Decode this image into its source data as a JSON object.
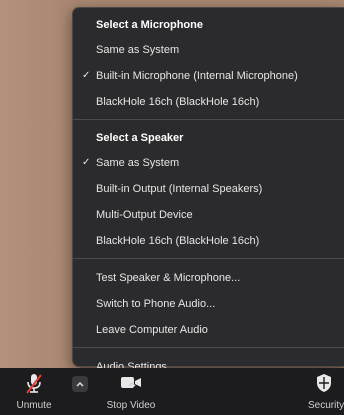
{
  "menu": {
    "microphone_header": "Select a Microphone",
    "microphone_items": [
      {
        "label": "Same as System",
        "checked": false
      },
      {
        "label": "Built-in Microphone (Internal Microphone)",
        "checked": true
      },
      {
        "label": "BlackHole 16ch (BlackHole 16ch)",
        "checked": false
      }
    ],
    "speaker_header": "Select a Speaker",
    "speaker_items": [
      {
        "label": "Same as System",
        "checked": true
      },
      {
        "label": "Built-in Output (Internal Speakers)",
        "checked": false
      },
      {
        "label": "Multi-Output Device",
        "checked": false
      },
      {
        "label": "BlackHole 16ch (BlackHole 16ch)",
        "checked": false
      }
    ],
    "actions": [
      "Test Speaker & Microphone...",
      "Switch to Phone Audio...",
      "Leave Computer Audio"
    ],
    "settings": "Audio Settings...",
    "check_mark": "✓"
  },
  "toolbar": {
    "unmute_label": "Unmute",
    "stop_video_label": "Stop Video",
    "security_label": "Security"
  },
  "icons": {
    "muted_mic": "mic-muted-icon",
    "audio_menu_caret": "chevron-up-icon",
    "video": "video-camera-icon",
    "video_menu_caret": "chevron-up-icon",
    "security": "shield-icon"
  },
  "colors": {
    "menu_background": "#2b2b2d",
    "toolbar_background": "#1c1c1e",
    "muted_slash": "#e53935"
  }
}
